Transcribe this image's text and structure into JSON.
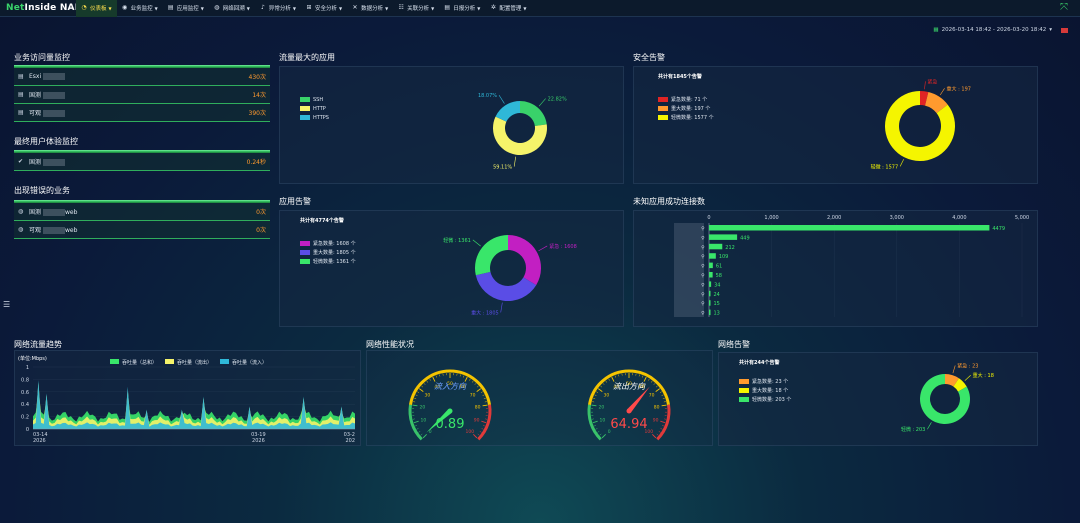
{
  "app": {
    "logo_net": "Net",
    "logo_rest": "Inside NAPM"
  },
  "nav": [
    {
      "label": "仪表板",
      "icon": "dashboard-icon",
      "glyph": "◔",
      "active": true
    },
    {
      "label": "业务监控",
      "icon": "globe-icon",
      "glyph": "◉"
    },
    {
      "label": "应用监控",
      "icon": "document-icon",
      "glyph": "▤"
    },
    {
      "label": "网络回溯",
      "icon": "globe-icon",
      "glyph": "◍"
    },
    {
      "label": "异常分析",
      "icon": "bell-icon",
      "glyph": "♪"
    },
    {
      "label": "安全分析",
      "icon": "plus-square-icon",
      "glyph": "⊞"
    },
    {
      "label": "数据分析",
      "icon": "shuffle-icon",
      "glyph": "✕"
    },
    {
      "label": "关联分析",
      "icon": "sliders-icon",
      "glyph": "☷"
    },
    {
      "label": "日报分析",
      "icon": "list-icon",
      "glyph": "▤"
    },
    {
      "label": "配置管理",
      "icon": "gear-icon",
      "glyph": "✲"
    }
  ],
  "date_range": "2026-03-14 18:42 - 2026-03-20 18:42",
  "biz_visit": {
    "title": "业务访问量监控",
    "rows": [
      {
        "label": "Esxi",
        "value": "430次"
      },
      {
        "label": "国测",
        "value": "14次"
      },
      {
        "label": "可观",
        "value": "390次"
      }
    ]
  },
  "user_exp": {
    "title": "最终用户体验监控",
    "rows": [
      {
        "label": "国测",
        "value": "0.24秒"
      }
    ]
  },
  "err_biz": {
    "title": "出现错误的业务",
    "rows": [
      {
        "label": "国测",
        "suffix": "web",
        "value": "0次"
      },
      {
        "label": "可观",
        "suffix": "web",
        "value": "0次"
      }
    ]
  },
  "top_apps": {
    "title": "流量最大的应用",
    "legend": [
      {
        "name": "SSH",
        "color": "#39d26a"
      },
      {
        "name": "HTTP",
        "color": "#f5f36a"
      },
      {
        "name": "HTTPS",
        "color": "#2fb8d8"
      }
    ],
    "slices": [
      {
        "name": "SSH",
        "pct": 22.82,
        "label": "22.82%",
        "color": "#39d26a"
      },
      {
        "name": "HTTP",
        "pct": 59.11,
        "label": "59.11%",
        "color": "#f5f36a"
      },
      {
        "name": "HTTPS",
        "pct": 18.07,
        "label": "18.07%",
        "color": "#2fb8d8"
      }
    ]
  },
  "security": {
    "title": "安全告警",
    "total": "共计有1845个告警",
    "legend": [
      {
        "name": "紧急数量: 71 个",
        "color": "#e02424"
      },
      {
        "name": "重大数量: 197 个",
        "color": "#ff9a2e"
      },
      {
        "name": "轻微数量: 1577 个",
        "color": "#f5f500"
      }
    ],
    "slices": [
      {
        "value": 71,
        "color": "#e02424",
        "label": "紧急"
      },
      {
        "value": 197,
        "color": "#ff9a2e",
        "label": "重大 : 197"
      },
      {
        "value": 1577,
        "color": "#f5f500",
        "label": "轻微 : 1577"
      }
    ]
  },
  "app_alarm": {
    "title": "应用告警",
    "total": "共计有4774个告警",
    "legend": [
      {
        "name": "紧急数量: 1608 个",
        "color": "#c21fc2"
      },
      {
        "name": "重大数量: 1805 个",
        "color": "#5a4de6"
      },
      {
        "name": "轻微数量: 1361 个",
        "color": "#39e66a"
      }
    ],
    "slices": [
      {
        "value": 1608,
        "color": "#c21fc2",
        "label": "紧急 : 1608"
      },
      {
        "value": 1805,
        "color": "#5a4de6",
        "label": "重大 : 1805"
      },
      {
        "value": 1361,
        "color": "#39e66a",
        "label": "轻微 : 1361"
      }
    ]
  },
  "unknown_conn": {
    "title": "未知应用成功连接数",
    "chart_data": {
      "type": "bar",
      "orientation": "horizontal",
      "x_ticks": [
        "0",
        "1,000",
        "2,000",
        "3,000",
        "4,000",
        "5,000"
      ],
      "xlim": [
        0,
        5000
      ],
      "values": [
        4479,
        449,
        212,
        109,
        61,
        58,
        34,
        24,
        15,
        13
      ]
    }
  },
  "traffic": {
    "title": "网络流量趋势",
    "chart_data": {
      "type": "area",
      "ylabel": "(单位:Mbps)",
      "y_ticks": [
        "0",
        "0.2",
        "0.4",
        "0.6",
        "0.8",
        "1"
      ],
      "ylim": [
        0,
        1
      ],
      "x_ticks": [
        "03-14\n2026",
        "03-19\n2026",
        "03-2\n202"
      ],
      "series": [
        {
          "name": "吞吐量（总和）",
          "color": "#39e66a"
        },
        {
          "name": "吞吐量（流出）",
          "color": "#f5f36a"
        },
        {
          "name": "吞吐量（流入）",
          "color": "#2fb8d8"
        }
      ]
    }
  },
  "net_perf": {
    "title": "网络性能状况",
    "gauges": [
      {
        "label": "流入方向",
        "value": 0.89,
        "display": "0.89",
        "color": "#39e66a",
        "label_color": "#6fa0ff"
      },
      {
        "label": "流出方向",
        "value": 64.94,
        "display": "64.94",
        "color": "#ff4a4a",
        "label_color": "#ffffff"
      }
    ],
    "ticks": [
      "0",
      "10",
      "20",
      "30",
      "40",
      "50",
      "60",
      "70",
      "80",
      "90",
      "100"
    ]
  },
  "net_alarm": {
    "title": "网络告警",
    "total": "共计有244个告警",
    "legend": [
      {
        "name": "紧急数量: 23 个",
        "color": "#ff9a2e"
      },
      {
        "name": "重大数量: 18 个",
        "color": "#f5f500"
      },
      {
        "name": "轻微数量: 203 个",
        "color": "#39e66a"
      }
    ],
    "slices": [
      {
        "value": 23,
        "color": "#ff9a2e",
        "label": "紧急 : 23"
      },
      {
        "value": 18,
        "color": "#f5f500",
        "label": "重大 : 18"
      },
      {
        "value": 203,
        "color": "#39e66a",
        "label": "轻微 : 203"
      }
    ]
  }
}
